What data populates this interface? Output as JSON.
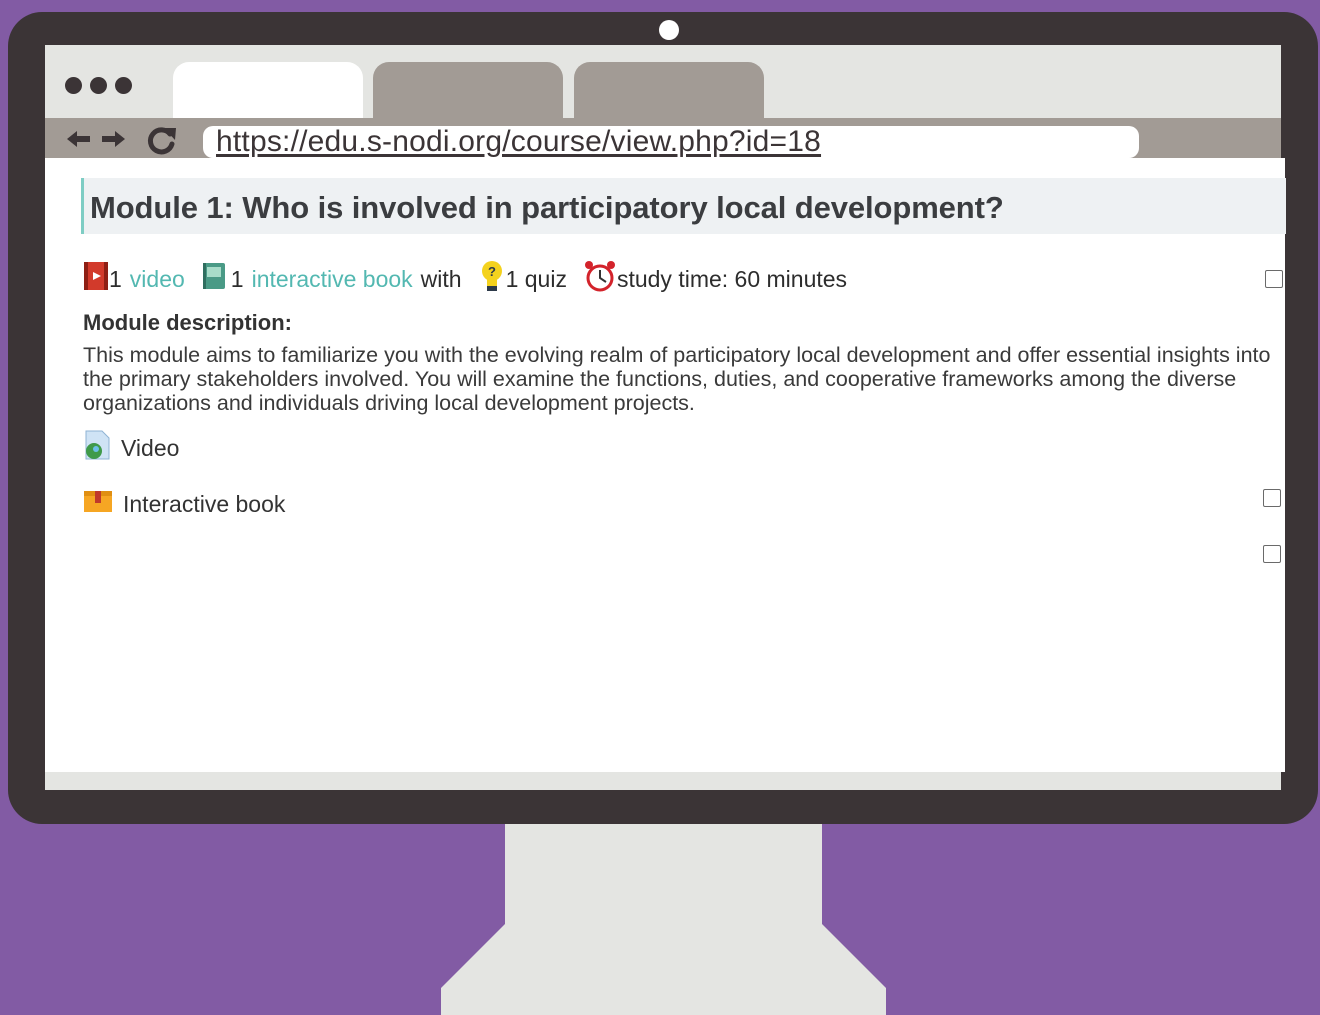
{
  "browser": {
    "url": "https://edu.s-nodi.org/course/view.php?id=18",
    "tabs": [
      {
        "state": "active"
      },
      {
        "state": "inactive"
      },
      {
        "state": "inactive"
      }
    ]
  },
  "module": {
    "title": "Module 1: Who is involved in participatory local development?",
    "summary": {
      "video_count": "1",
      "video_link": "video",
      "book_count": "1",
      "book_link": "interactive book",
      "with_text": "with",
      "quiz_text": "1 quiz",
      "study_time": "study time: 60 minutes"
    },
    "description_label": "Module description:",
    "description": "This module aims to familiarize you with the evolving realm of participatory local development and offer essential insights into the primary stakeholders involved. You will examine the functions, duties, and cooperative frameworks among the diverse organizations and individuals driving local development projects.",
    "activities": [
      {
        "label": "Video",
        "icon": "video-file-icon",
        "completed": false
      },
      {
        "label": "Interactive book",
        "icon": "interactive-book-icon",
        "completed": false
      }
    ]
  },
  "colors": {
    "background": "#825ba4",
    "monitor": "#3b3436",
    "frame": "#e4e5e2",
    "tab_inactive": "#a29b95",
    "link": "#53b8b1",
    "header_accent": "#7ecdc4"
  }
}
